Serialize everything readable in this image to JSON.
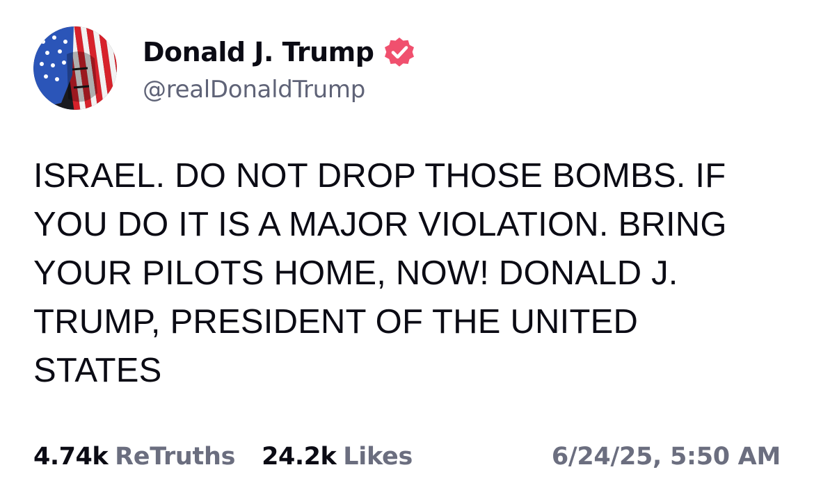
{
  "author": {
    "display_name": "Donald J. Trump",
    "handle": "@realDonaldTrump",
    "verified": true,
    "avatar_icon": "stars-and-stripes-portrait-avatar",
    "verified_icon": "verified-badge-icon",
    "verified_color": "#f0506e"
  },
  "post": {
    "text": "ISRAEL. DO NOT DROP THOSE BOMBS. IF YOU DO IT IS A MAJOR VIOLATION. BRING YOUR PILOTS HOME, NOW! DONALD J. TRUMP, PRESIDENT OF THE UNITED STATES"
  },
  "stats": {
    "retruths_count": "4.74k",
    "retruths_label": "ReTruths",
    "likes_count": "24.2k",
    "likes_label": "Likes"
  },
  "timestamp": "6/24/25, 5:50 AM",
  "colors": {
    "text": "#0b0b14",
    "muted": "#6b6e7f",
    "background": "#ffffff"
  }
}
